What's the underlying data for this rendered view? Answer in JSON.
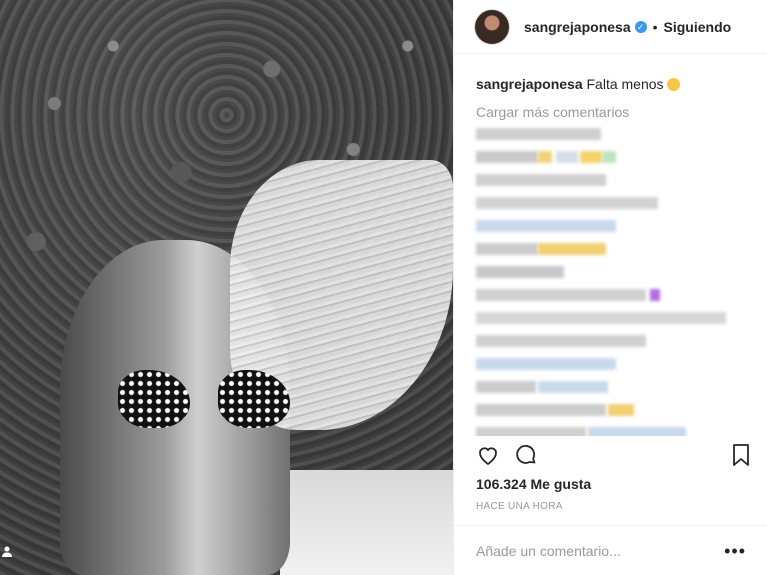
{
  "post": {
    "username": "sangrejaponesa",
    "separator": "•",
    "following_label": "Siguiendo",
    "caption_text": "Falta menos",
    "load_more_label": "Cargar más comentarios",
    "likes_count": "106.324",
    "likes_label": "Me gusta",
    "timestamp": "HACE UNA HORA",
    "comment_placeholder": "Añade un comentario...",
    "more_icon": "•••"
  },
  "colors": {
    "verified": "#3897f0",
    "muted_text": "#999999",
    "border": "#efefef"
  },
  "icons": [
    "verified-badge-icon",
    "heart-icon",
    "comment-icon",
    "bookmark-icon",
    "more-options-icon",
    "user-tag-icon"
  ]
}
